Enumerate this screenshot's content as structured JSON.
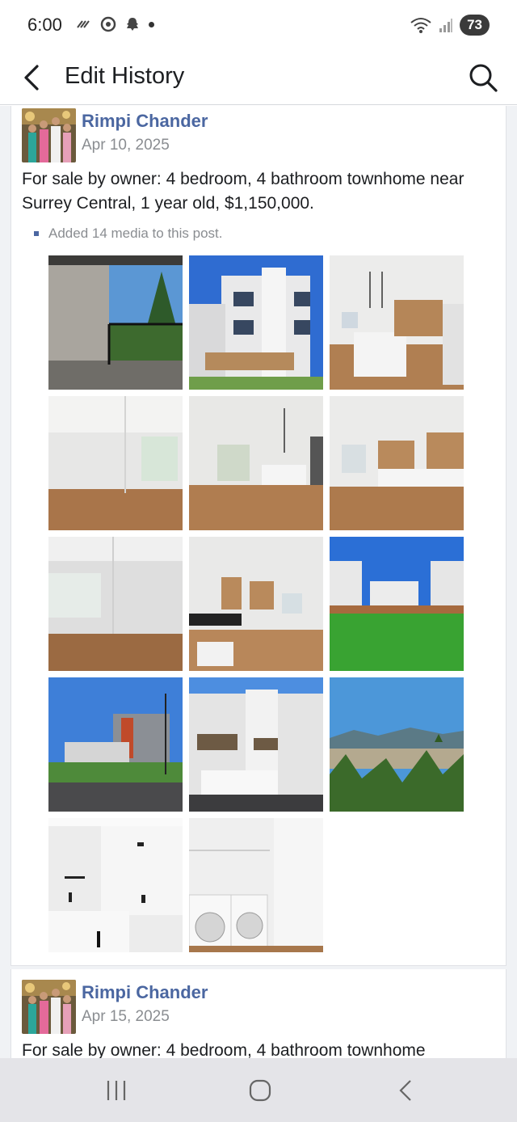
{
  "status_bar": {
    "time": "6:00",
    "battery": "73"
  },
  "header": {
    "title": "Edit History"
  },
  "posts": [
    {
      "author": "Rimpi Chander",
      "date": "Apr 10, 2025",
      "text": "For sale by owner: 4 bedroom, 4 bathroom townhome near Surrey Central, 1 year old, $1,150,000.",
      "media_note": "Added 14 media to this post."
    },
    {
      "author": "Rimpi Chander",
      "date": "Apr 15, 2025",
      "text": "For sale by owner: 4 bedroom, 4 bathroom townhome"
    }
  ],
  "icons": {
    "back": "chevron-left-icon",
    "search": "search-icon",
    "nav_recent": "recent-apps-icon",
    "nav_home": "home-icon",
    "nav_back": "back-icon"
  },
  "colors": {
    "author_link": "#4b67a1",
    "secondary_text": "#8a8d91",
    "background": "#f0f2f5"
  }
}
